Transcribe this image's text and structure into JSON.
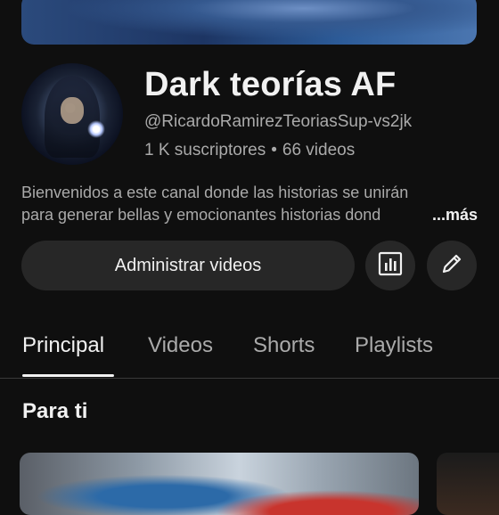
{
  "channel": {
    "name": "Dark teorías AF",
    "handle": "@RicardoRamirezTeoriasSup-vs2jk",
    "subscribers": "1 K suscriptores",
    "separator": "•",
    "videos_count": "66 videos",
    "description_line1": "Bienvenidos a este canal donde las historias se unirán",
    "description_line2": "para generar bellas y emocionantes historias dond",
    "more_label": "...más"
  },
  "actions": {
    "manage_label": "Administrar videos",
    "analytics_icon": "analytics-icon",
    "edit_icon": "pencil-icon"
  },
  "tabs": [
    {
      "label": "Principal",
      "active": true
    },
    {
      "label": "Videos"
    },
    {
      "label": "Shorts"
    },
    {
      "label": "Playlists"
    }
  ],
  "section": {
    "title": "Para ti"
  },
  "colors": {
    "background": "#0f0f0f",
    "text": "#f1f1f1",
    "muted": "#aaaaaa",
    "button": "#272727"
  }
}
